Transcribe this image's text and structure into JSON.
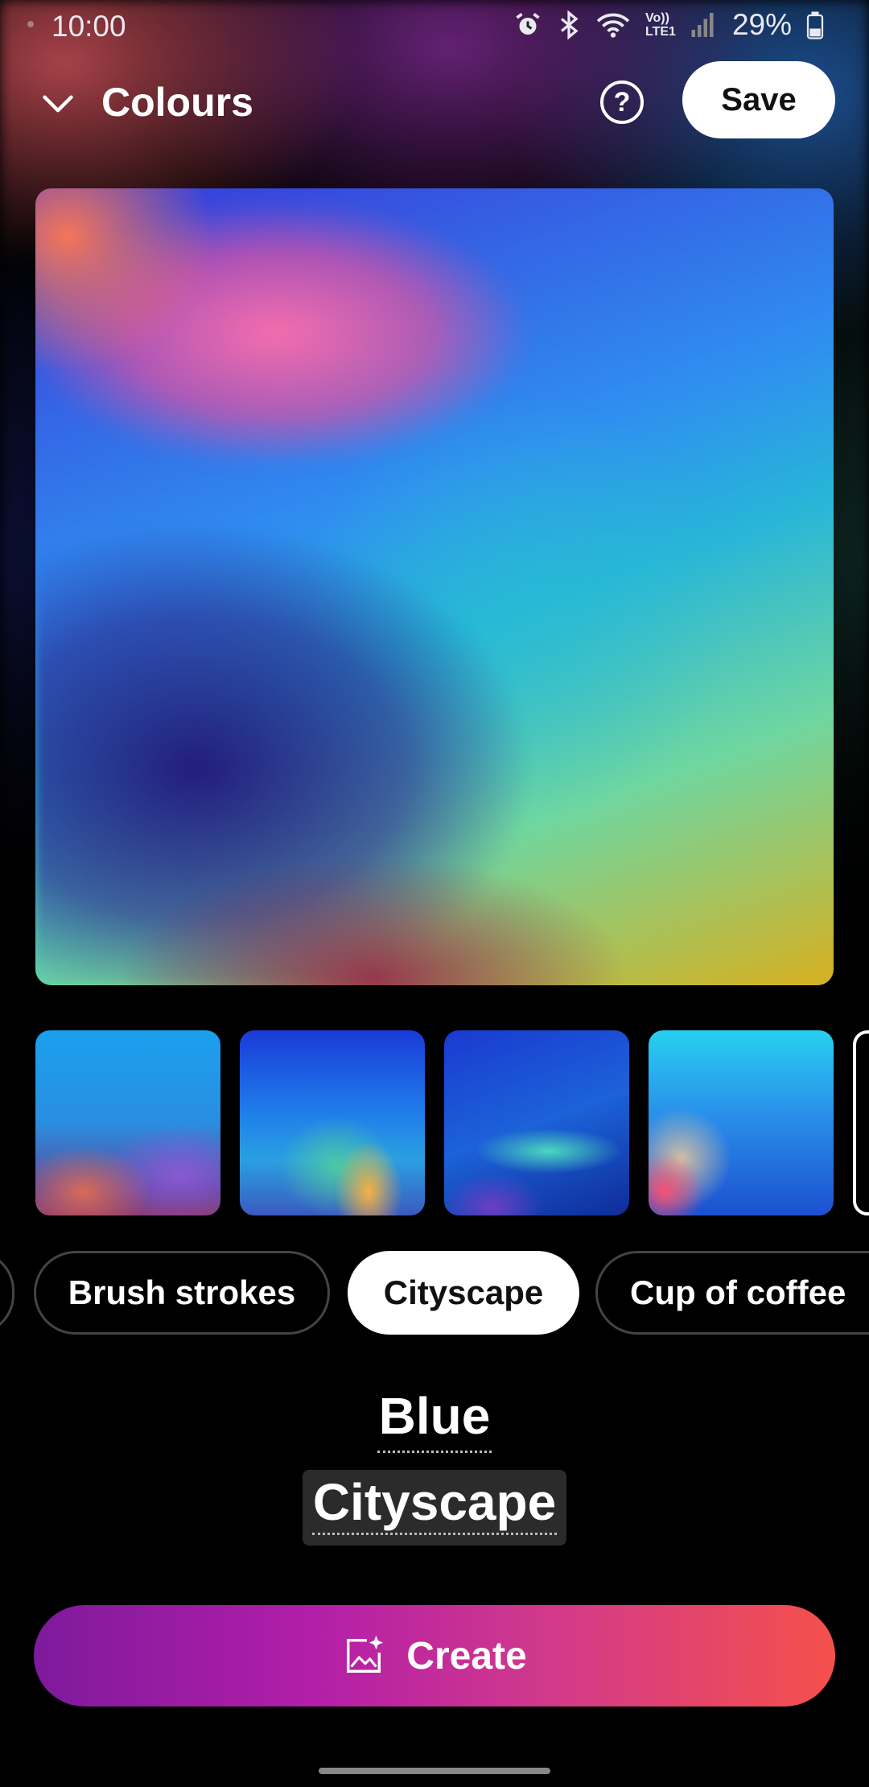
{
  "status_bar": {
    "time": "10:00",
    "battery_percent": "29%",
    "network_label_top": "Vo))",
    "network_label_bottom": "LTE1",
    "icons": [
      "alarm-icon",
      "bluetooth-icon",
      "wifi-icon",
      "signal-icon",
      "battery-icon"
    ]
  },
  "header": {
    "title": "Colours",
    "help_label": "?",
    "save_label": "Save"
  },
  "thumbnails": [
    {
      "name": "style-thumbnail-1"
    },
    {
      "name": "style-thumbnail-2"
    },
    {
      "name": "style-thumbnail-3"
    },
    {
      "name": "style-thumbnail-4"
    },
    {
      "name": "style-thumbnail-5"
    }
  ],
  "chips": {
    "items": [
      {
        "label": ""
      },
      {
        "label": "Brush strokes"
      },
      {
        "label": "Cityscape",
        "selected": true
      },
      {
        "label": "Cup of coffee"
      }
    ]
  },
  "prompt": {
    "word1": "Blue",
    "word2": "Cityscape"
  },
  "create_button": {
    "label": "Create",
    "icon": "image-sparkle-icon"
  },
  "colors": {
    "create_gradient_start": "#7e1a9c",
    "create_gradient_end": "#f5504a",
    "selected_chip_bg": "#ffffff",
    "background": "#000000"
  }
}
